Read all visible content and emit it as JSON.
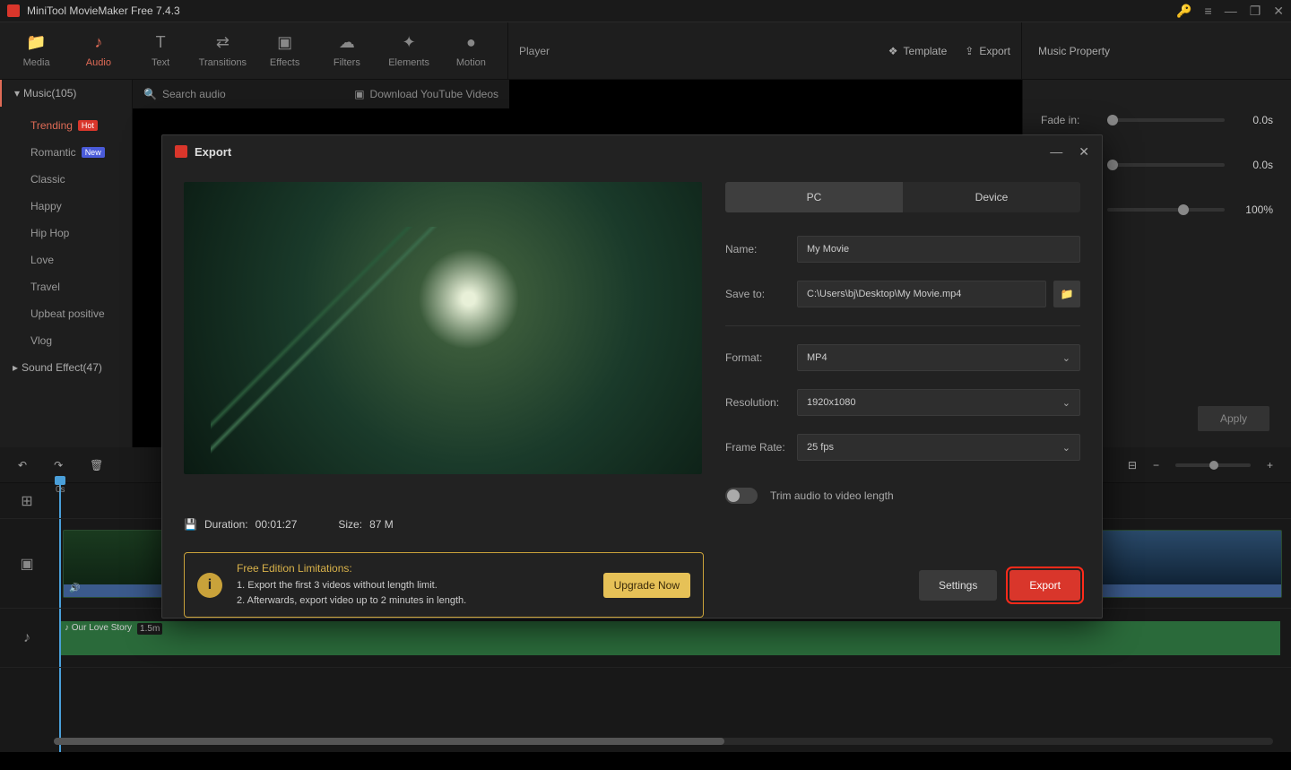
{
  "app": {
    "title": "MiniTool MovieMaker Free 7.4.3"
  },
  "toolbar": {
    "items": [
      {
        "icon": "📁",
        "label": "Media"
      },
      {
        "icon": "♪",
        "label": "Audio"
      },
      {
        "icon": "T",
        "label": "Text"
      },
      {
        "icon": "⇄",
        "label": "Transitions"
      },
      {
        "icon": "▣",
        "label": "Effects"
      },
      {
        "icon": "☁",
        "label": "Filters"
      },
      {
        "icon": "✦",
        "label": "Elements"
      },
      {
        "icon": "●",
        "label": "Motion"
      }
    ],
    "player": "Player",
    "template": "Template",
    "export": "Export",
    "music_property": "Music Property"
  },
  "sidebar": {
    "music_label": "Music(105)",
    "search_placeholder": "Search audio",
    "download": "Download YouTube Videos",
    "items": [
      {
        "label": "Trending",
        "badge": "Hot"
      },
      {
        "label": "Romantic",
        "badge": "New"
      },
      {
        "label": "Classic"
      },
      {
        "label": "Happy"
      },
      {
        "label": "Hip Hop"
      },
      {
        "label": "Love"
      },
      {
        "label": "Travel"
      },
      {
        "label": "Upbeat positive"
      },
      {
        "label": "Vlog"
      }
    ],
    "sound_effect": "Sound Effect(47)"
  },
  "props": {
    "fadein_label": "Fade in:",
    "fadein_val": "0.0s",
    "fadeout_val": "0.0s",
    "volume_val": "100%",
    "apply": "Apply"
  },
  "timeline": {
    "playhead": "0s",
    "audio_name": "Our Love Story",
    "audio_dur": "1.5m"
  },
  "modal": {
    "title": "Export",
    "tab_pc": "PC",
    "tab_device": "Device",
    "name_label": "Name:",
    "name_value": "My Movie",
    "save_label": "Save to:",
    "save_value": "C:\\Users\\bj\\Desktop\\My Movie.mp4",
    "format_label": "Format:",
    "format_value": "MP4",
    "resolution_label": "Resolution:",
    "resolution_value": "1920x1080",
    "framerate_label": "Frame Rate:",
    "framerate_value": "25 fps",
    "trim_label": "Trim audio to video length",
    "duration_label": "Duration:",
    "duration_value": "00:01:27",
    "size_label": "Size:",
    "size_value": "87 M",
    "upsell_title": "Free Edition Limitations:",
    "upsell_line1": "1. Export the first 3 videos without length limit.",
    "upsell_line2": "2. Afterwards, export video up to 2 minutes in length.",
    "upgrade": "Upgrade Now",
    "settings": "Settings",
    "export": "Export"
  }
}
